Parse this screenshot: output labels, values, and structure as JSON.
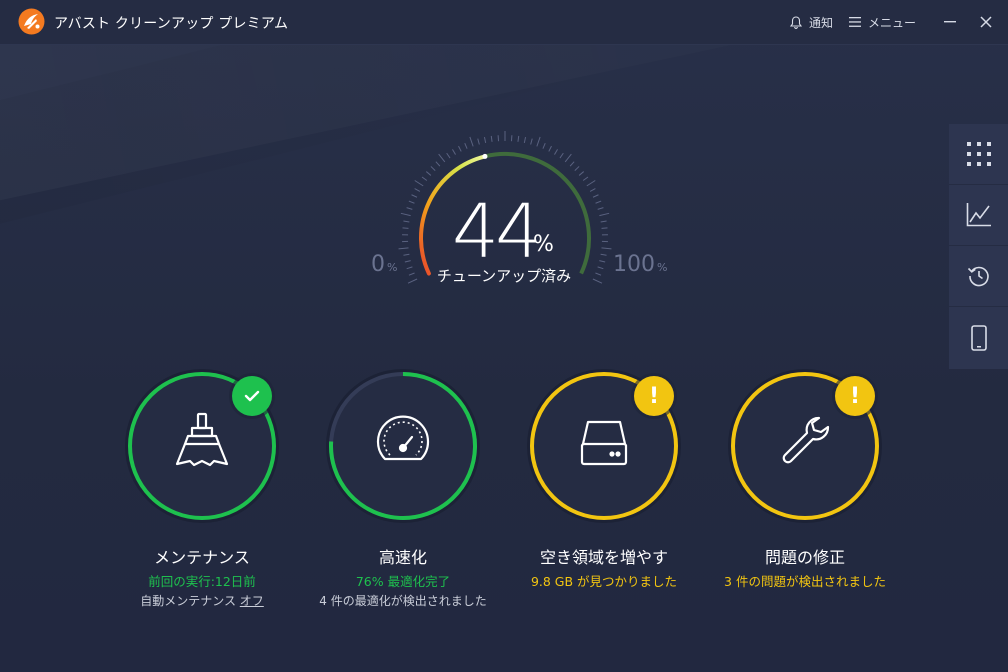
{
  "app": {
    "title": "アバスト クリーンアップ プレミアム"
  },
  "titlebar": {
    "notifications_label": "通知",
    "menu_label": "メニュー"
  },
  "gauge": {
    "value": "44",
    "unit": "%",
    "percent": 44,
    "label": "チューンアップ済み",
    "min_value": "0",
    "min_unit": "%",
    "max_value": "100",
    "max_unit": "%"
  },
  "sidebar": {
    "items": [
      {
        "name": "grid-icon"
      },
      {
        "name": "chart-icon"
      },
      {
        "name": "history-icon"
      },
      {
        "name": "mobile-icon"
      }
    ]
  },
  "tiles": [
    {
      "title": "メンテナンス",
      "status": "前回の実行:12日前",
      "sub_prefix": "自動メンテナンス ",
      "sub_link": "オフ",
      "ring_color": "#1ec14e",
      "status_color": "#1ec14e",
      "badge": "check"
    },
    {
      "title": "高速化",
      "status": "76% 最適化完了",
      "sub": "4 件の最適化が検出されました",
      "progress": 0.76,
      "ring_color": "#1ec14e",
      "status_color": "#1ec14e"
    },
    {
      "title": "空き領域を増やす",
      "status": "9.8 GB が見つかりました",
      "ring_color": "#f2c511",
      "status_color": "#f2c511",
      "badge": "!"
    },
    {
      "title": "問題の修正",
      "status": "3 件の問題が検出されました",
      "ring_color": "#f2c511",
      "status_color": "#f2c511",
      "badge": "!"
    }
  ]
}
